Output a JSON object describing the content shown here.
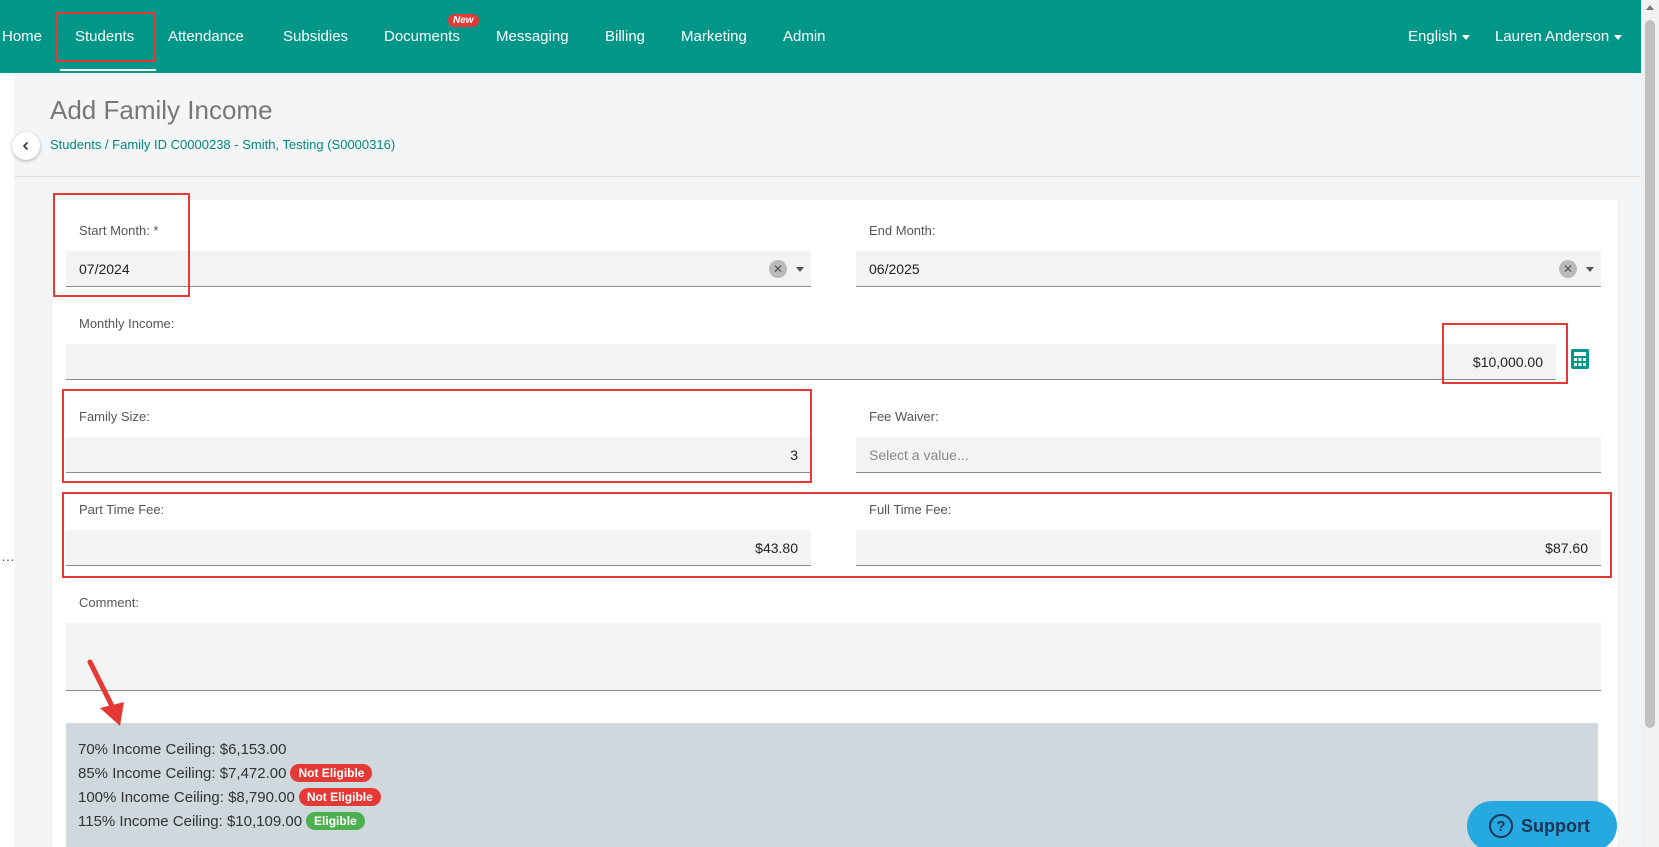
{
  "nav": {
    "items": [
      {
        "label": "Home"
      },
      {
        "label": "Students"
      },
      {
        "label": "Attendance"
      },
      {
        "label": "Subsidies"
      },
      {
        "label": "Documents"
      },
      {
        "label": "Messaging"
      },
      {
        "label": "Billing"
      },
      {
        "label": "Marketing"
      },
      {
        "label": "Admin"
      }
    ],
    "documents_badge": "New",
    "language": "English",
    "user": "Lauren Anderson"
  },
  "header": {
    "title": "Add Family Income",
    "breadcrumb": "Students / Family ID C0000238 - Smith, Testing (S0000316)"
  },
  "form": {
    "start_month": {
      "label": "Start Month: *",
      "value": "07/2024"
    },
    "end_month": {
      "label": "End Month:",
      "value": "06/2025"
    },
    "monthly_income": {
      "label": "Monthly Income:",
      "value": "$10,000.00"
    },
    "family_size": {
      "label": "Family Size:",
      "value": "3"
    },
    "fee_waiver": {
      "label": "Fee Waiver:",
      "placeholder": "Select a value..."
    },
    "part_time_fee": {
      "label": "Part Time Fee:",
      "value": "$43.80"
    },
    "full_time_fee": {
      "label": "Full Time Fee:",
      "value": "$87.60"
    },
    "comment": {
      "label": "Comment:",
      "value": ""
    }
  },
  "ceilings": [
    {
      "text": "70% Income Ceiling: $6,153.00",
      "status": ""
    },
    {
      "text": "85% Income Ceiling: $7,472.00",
      "status": "Not Eligible"
    },
    {
      "text": "100% Income Ceiling: $8,790.00",
      "status": "Not Eligible"
    },
    {
      "text": "115% Income Ceiling: $10,109.00",
      "status": "Eligible"
    }
  ],
  "colors": {
    "nav_bg": "#009688",
    "accent": "#00897b",
    "not_eligible": "#e53935",
    "eligible": "#4caf50",
    "support": "#26a9e0"
  },
  "support": {
    "label": "Support"
  },
  "icons": {
    "collapse": "chevron-left-icon",
    "calculator": "calculator-icon",
    "support": "question-circle-icon"
  }
}
